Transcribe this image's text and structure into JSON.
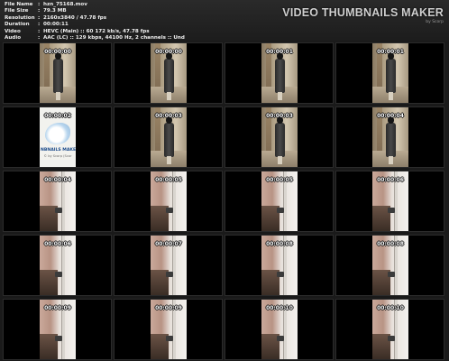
{
  "header": {
    "meta": [
      {
        "key": "File Name",
        "value": "hzn_75168.mov"
      },
      {
        "key": "File Size",
        "value": "79.3 MB"
      },
      {
        "key": "Resolution",
        "value": "2160x3840 / 47.78 fps"
      },
      {
        "key": "Duration",
        "value": "00:00:11"
      },
      {
        "key": "Video",
        "value": "HEVC (Main) :: 60 172 kb/s, 47.78 fps"
      },
      {
        "key": "Audio",
        "value": "AAC (LC) :: 129 kbps, 44100 Hz, 2 channels :: Und"
      }
    ],
    "separator": ":",
    "brand_title": "VIDEO THUMBNAILS MAKER",
    "brand_sub": "by Scorp"
  },
  "logo": {
    "text": "NBNAILS MAKER",
    "sub": "© by Scorp (Scor"
  },
  "thumbnails": [
    {
      "scene": "standing",
      "timecode": "00:00:00"
    },
    {
      "scene": "standing",
      "timecode": "00:00:00"
    },
    {
      "scene": "standing",
      "timecode": "00:00:01"
    },
    {
      "scene": "standing",
      "timecode": "00:00:01"
    },
    {
      "scene": "logo",
      "timecode": "00:00:02"
    },
    {
      "scene": "standing",
      "timecode": "00:00:03"
    },
    {
      "scene": "standing",
      "timecode": "00:00:03"
    },
    {
      "scene": "standing",
      "timecode": "00:00:04"
    },
    {
      "scene": "close",
      "timecode": "00:00:04"
    },
    {
      "scene": "close",
      "timecode": "00:00:05"
    },
    {
      "scene": "close",
      "timecode": "00:00:05"
    },
    {
      "scene": "close",
      "timecode": "00:00:06"
    },
    {
      "scene": "close",
      "timecode": "00:00:06"
    },
    {
      "scene": "close",
      "timecode": "00:00:07"
    },
    {
      "scene": "close",
      "timecode": "00:00:08"
    },
    {
      "scene": "close",
      "timecode": "00:00:08"
    },
    {
      "scene": "close",
      "timecode": "00:00:09"
    },
    {
      "scene": "close",
      "timecode": "00:00:09"
    },
    {
      "scene": "close",
      "timecode": "00:00:10"
    },
    {
      "scene": "close",
      "timecode": "00:00:10"
    }
  ]
}
